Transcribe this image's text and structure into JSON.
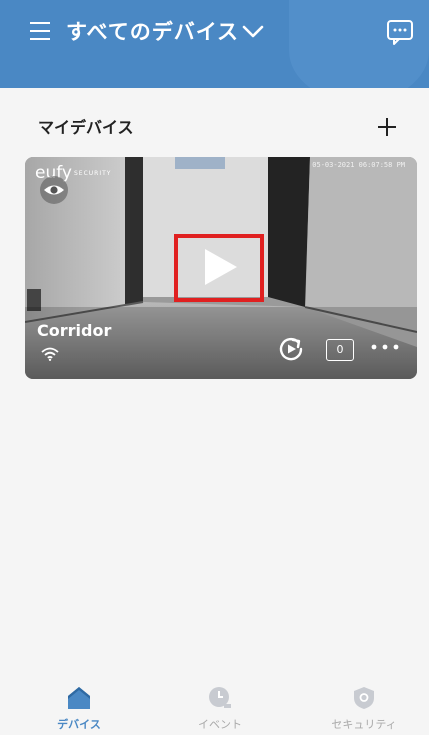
{
  "header": {
    "title": "すべてのデバイス",
    "accent_color": "#4a88c4"
  },
  "section": {
    "title": "マイデバイス"
  },
  "camera_card": {
    "brand": "eufy",
    "brand_sub": "SECURITY",
    "timestamp": "05-03-2021 06:07:58 PM",
    "name": "Corridor",
    "event_count": "0",
    "highlight_color": "#e02020"
  },
  "bottom_nav": {
    "items": [
      {
        "label": "デバイス",
        "icon": "home-icon",
        "active": true
      },
      {
        "label": "イベント",
        "icon": "clock-icon",
        "active": false
      },
      {
        "label": "セキュリティ",
        "icon": "shield-icon",
        "active": false
      }
    ]
  }
}
